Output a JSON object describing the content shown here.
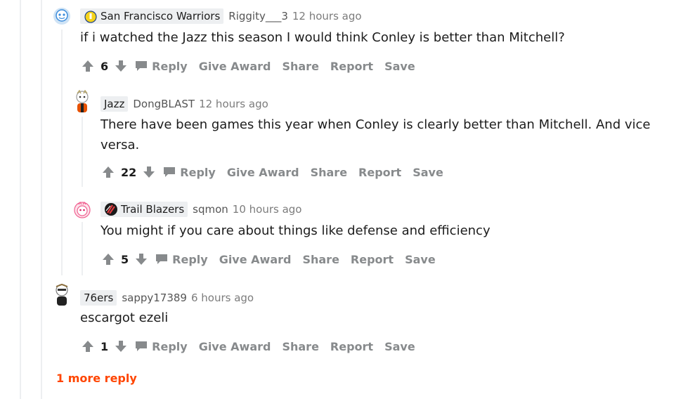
{
  "comments": [
    {
      "flair": "San Francisco Warriors",
      "username": "Riggity___3",
      "time": "12 hours ago",
      "body": "if i watched the Jazz this season I would think Conley is better than Mitchell?",
      "score": "6"
    },
    {
      "flair": "Jazz",
      "username": "DongBLAST",
      "time": "12 hours ago",
      "body": "There have been games this year when Conley is clearly better than Mitchell. And vice versa.",
      "score": "22"
    },
    {
      "flair": "Trail Blazers",
      "username": "sqmon",
      "time": "10 hours ago",
      "body": "You might if you care about things like defense and efficiency",
      "score": "5"
    },
    {
      "flair": "76ers",
      "username": "sappy17389",
      "time": "6 hours ago",
      "body": "escargot ezeli",
      "score": "1"
    }
  ],
  "actions": {
    "reply": "Reply",
    "give_award": "Give Award",
    "share": "Share",
    "report": "Report",
    "save": "Save"
  },
  "more_replies": "1 more reply",
  "colors": {
    "accent": "#ff4500",
    "action_gray": "#878a8c",
    "thread_line": "#edeff1"
  }
}
